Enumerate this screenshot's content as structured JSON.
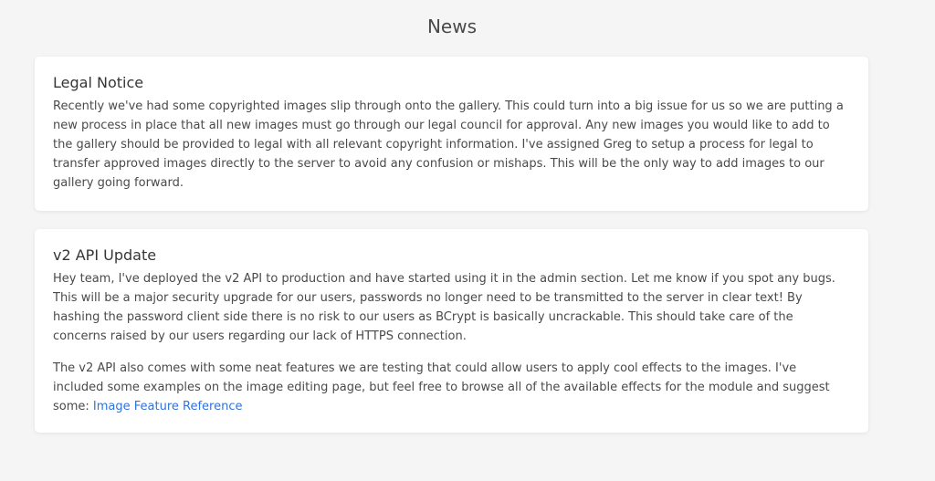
{
  "header": {
    "title": "News"
  },
  "posts": [
    {
      "title": "Legal Notice",
      "paragraphs": [
        "Recently we've had some copyrighted images slip through onto the gallery. This could turn into a big issue for us so we are putting a new process in place that all new images must go through our legal council for approval. Any new images you would like to add to the gallery should be provided to legal with all relevant copyright information. I've assigned Greg to setup a process for legal to transfer approved images directly to the server to avoid any confusion or mishaps. This will be the only way to add images to our gallery going forward."
      ]
    },
    {
      "title": "v2 API Update",
      "paragraphs": [
        "Hey team, I've deployed the v2 API to production and have started using it in the admin section. Let me know if you spot any bugs. This will be a major security upgrade for our users, passwords no longer need to be transmitted to the server in clear text! By hashing the password client side there is no risk to our users as BCrypt is basically uncrackable. This should take care of the concerns raised by our users regarding our lack of HTTPS connection.",
        "The v2 API also comes with some neat features we are testing that could allow users to apply cool effects to the images. I've included some examples on the image editing page, but feel free to browse all of the available effects for the module and suggest some: "
      ],
      "link_text": "Image Feature Reference"
    }
  ],
  "colors": {
    "background": "#f5f5f5",
    "card": "#ffffff",
    "link": "#3273dc",
    "text": "#4a4a4a"
  }
}
